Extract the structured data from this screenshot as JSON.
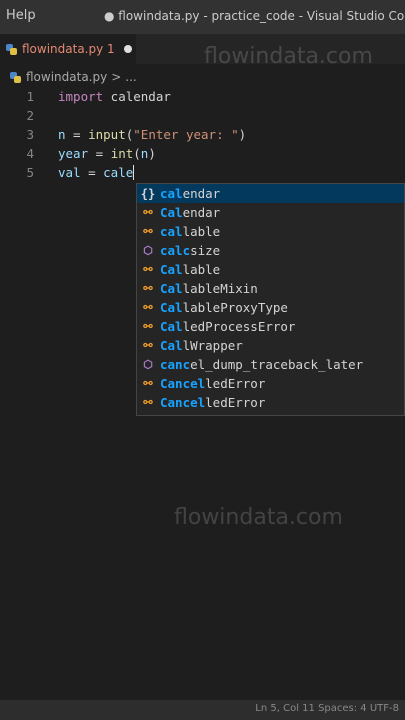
{
  "titlebar": {
    "menu_help": "Help",
    "window_title": "● flowindata.py - practice_code - Visual Studio Code"
  },
  "tab": {
    "label": "flowindata.py 1",
    "icon": "python-file-icon"
  },
  "breadcrumb": {
    "file": "flowindata.py",
    "separator": ">",
    "more": "..."
  },
  "editor": {
    "lines": [
      {
        "number": "1"
      },
      {
        "number": "2"
      },
      {
        "number": "3"
      },
      {
        "number": "4"
      },
      {
        "number": "5"
      }
    ],
    "tokens": {
      "l1_kw": "import",
      "l1_rest": " calendar",
      "l3_var": "n",
      "l3_eq": " = ",
      "l3_fn": "input",
      "l3_paren1": "(",
      "l3_str": "\"Enter year: \"",
      "l3_paren2": ")",
      "l4_var": "year",
      "l4_eq": " = ",
      "l4_fn": "int",
      "l4_paren1": "(",
      "l4_arg": "n",
      "l4_paren2": ")",
      "l5_var": "val",
      "l5_eq": " = ",
      "l5_typed": "cale"
    }
  },
  "suggestions": [
    {
      "icon": "module-icon",
      "match": "cal",
      "rest": "endar",
      "selected": true
    },
    {
      "icon": "class-icon",
      "match": "Cal",
      "rest": "endar"
    },
    {
      "icon": "class-icon",
      "match": "cal",
      "rest": "lable"
    },
    {
      "icon": "cube-icon",
      "match": "calc",
      "rest": "size"
    },
    {
      "icon": "class-icon",
      "match": "Cal",
      "rest": "lable"
    },
    {
      "icon": "class-icon",
      "match": "Cal",
      "rest": "lableMixin"
    },
    {
      "icon": "class-icon",
      "match": "Cal",
      "rest": "lableProxyType"
    },
    {
      "icon": "class-icon",
      "match": "Cal",
      "rest": "ledProcessError"
    },
    {
      "icon": "class-icon",
      "match": "Cal",
      "rest": "lWrapper"
    },
    {
      "icon": "cube-icon",
      "match": "canc",
      "rest": "el_dump_traceback_later"
    },
    {
      "icon": "class-icon",
      "match": "Cancel",
      "rest": "ledError"
    },
    {
      "icon": "class-icon",
      "match": "Cancel",
      "rest": "ledError"
    }
  ],
  "watermark": {
    "text": "flowindata.com"
  },
  "statusbar": {
    "text": "Ln 5, Col 11   Spaces: 4   UTF-8"
  },
  "colors": {
    "background": "#1e1e1e",
    "keyword": "#c586c0",
    "function": "#dcdcaa",
    "string": "#ce9178",
    "variable": "#9cdcfe",
    "match_highlight": "#18a3ff",
    "selected_suggestion": "#04395e",
    "tab_modified": "#e38a74"
  }
}
